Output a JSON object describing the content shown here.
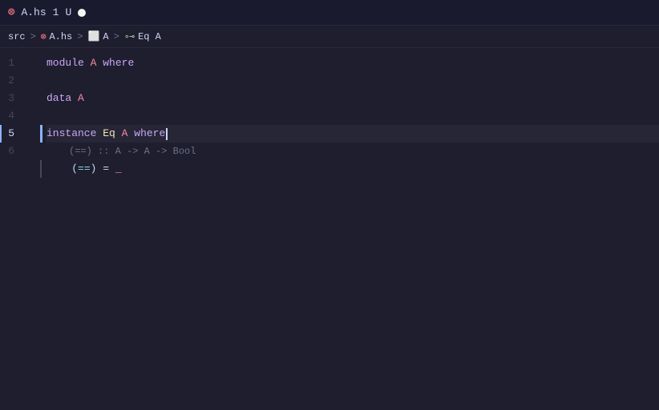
{
  "titlebar": {
    "icon": "⊗",
    "filename": "A.hs",
    "number": "1",
    "modified": "U"
  },
  "breadcrumb": {
    "src": "src",
    "sep1": ">",
    "hs_icon": "⊗",
    "file": "A.hs",
    "sep2": ">",
    "file_icon": "◻",
    "module": "A",
    "sep3": ">",
    "eq_icon": "∘⊸",
    "eq_class": "Eq A"
  },
  "lines": [
    {
      "num": "1",
      "content": "module A where",
      "tokens": [
        {
          "text": "module",
          "class": "kw-module"
        },
        {
          "text": " ",
          "class": "plain"
        },
        {
          "text": "A",
          "class": "type-name"
        },
        {
          "text": " ",
          "class": "plain"
        },
        {
          "text": "where",
          "class": "kw-where"
        }
      ]
    },
    {
      "num": "2",
      "content": "",
      "tokens": []
    },
    {
      "num": "3",
      "content": "data A",
      "tokens": [
        {
          "text": "data",
          "class": "kw-data"
        },
        {
          "text": " ",
          "class": "plain"
        },
        {
          "text": "A",
          "class": "type-name"
        }
      ]
    },
    {
      "num": "4",
      "content": "",
      "tokens": []
    },
    {
      "num": "5",
      "content": "instance Eq A where",
      "active": true,
      "tokens": [
        {
          "text": "instance",
          "class": "kw-instance"
        },
        {
          "text": " ",
          "class": "plain"
        },
        {
          "text": "Eq",
          "class": "type-class"
        },
        {
          "text": " ",
          "class": "plain"
        },
        {
          "text": "A",
          "class": "type-name"
        },
        {
          "text": " ",
          "class": "plain"
        },
        {
          "text": "where",
          "class": "kw-where"
        }
      ],
      "type_hint": "(==) :: A -> A -> Bool"
    },
    {
      "num": "6",
      "content": "    (==) = _",
      "tokens": [
        {
          "text": "    ",
          "class": "plain"
        },
        {
          "text": "(",
          "class": "paren"
        },
        {
          "text": "==",
          "class": "operator"
        },
        {
          "text": ")",
          "class": "paren"
        },
        {
          "text": " = ",
          "class": "plain"
        },
        {
          "text": "_",
          "class": "type-name"
        }
      ]
    }
  ],
  "cursor": {
    "line": 5,
    "col": 22
  }
}
